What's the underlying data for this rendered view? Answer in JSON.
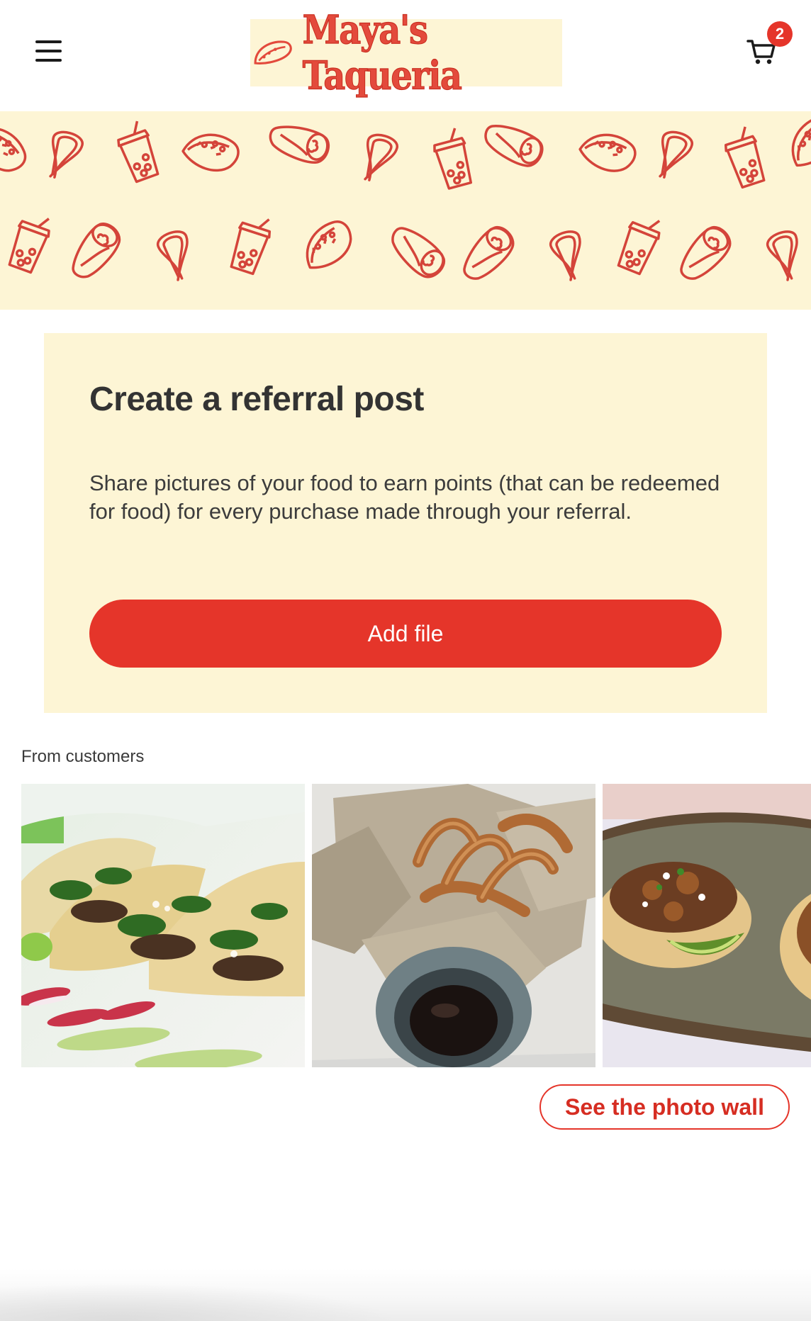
{
  "header": {
    "menu_icon": "hamburger-menu-icon",
    "logo_text": "Maya's Taqueria",
    "logo_icon": "taco-icon",
    "cart_icon": "shopping-cart-icon",
    "cart_count": "2"
  },
  "banner": {
    "pattern_icons": [
      "burrito-icon",
      "churro-icon",
      "boba-drink-icon",
      "taco-icon"
    ]
  },
  "referral": {
    "title": "Create a referral post",
    "description": "Share pictures of your food to earn points (that can be redeemed for food) for every purchase made through your referral.",
    "add_file_label": "Add file"
  },
  "gallery": {
    "label": "From customers",
    "photos": [
      "tacos-photo",
      "churros-photo",
      "tacos-plate-photo"
    ],
    "see_wall_label": "See the photo wall"
  },
  "colors": {
    "accent": "#e5352a",
    "cream": "#fdf5d5",
    "pattern_stroke": "#d4443a"
  }
}
